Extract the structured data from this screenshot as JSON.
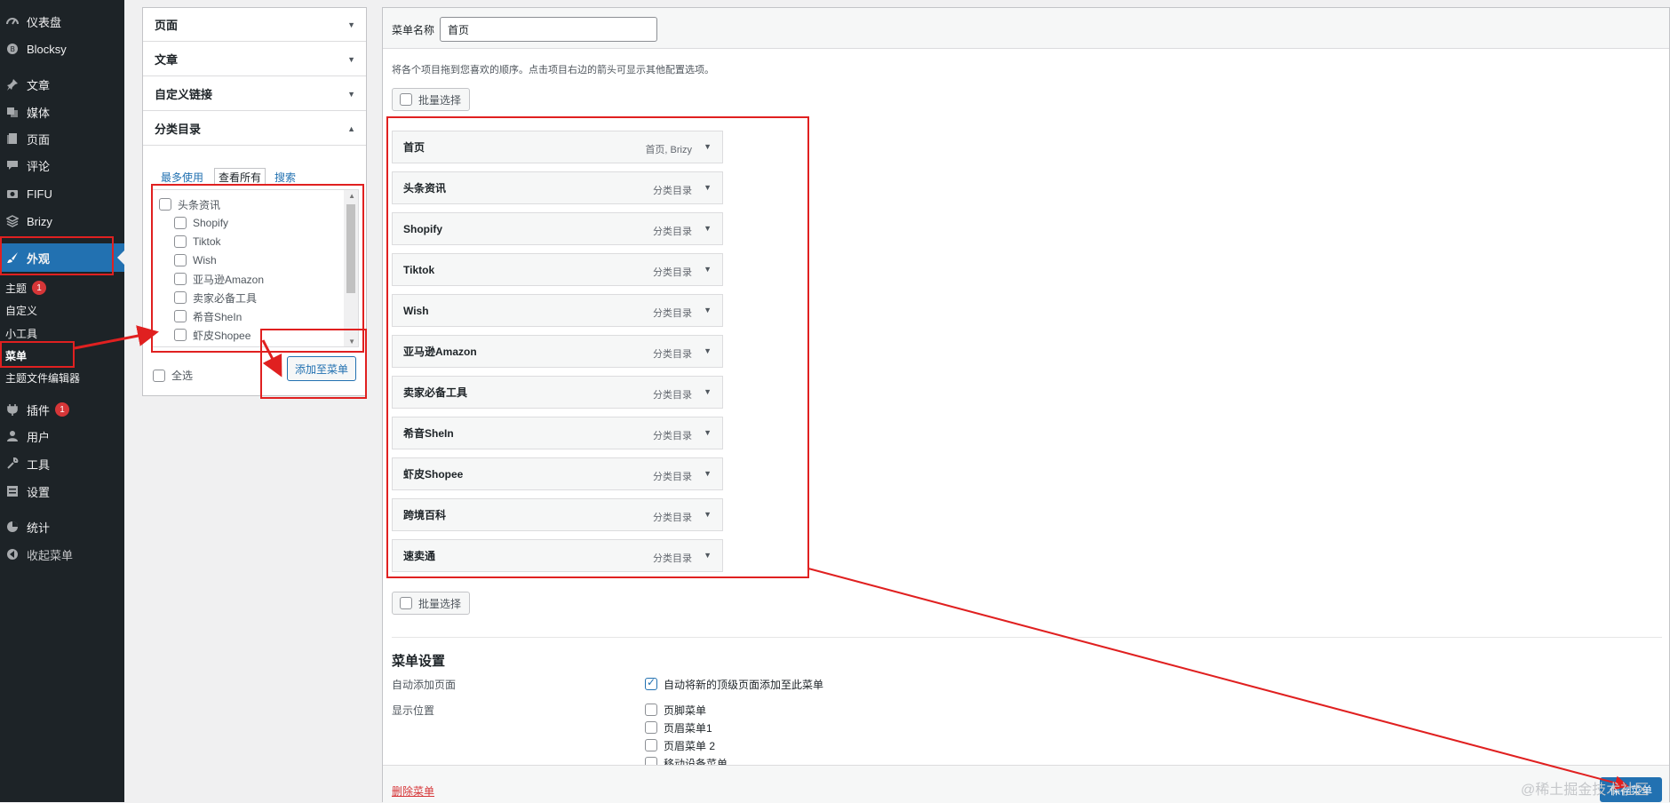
{
  "sidebar": {
    "items": [
      {
        "label": "仪表盘",
        "icon": "dashboard-icon"
      },
      {
        "label": "Blocksy",
        "icon": "blocksy-icon"
      },
      {
        "label": "文章",
        "icon": "pin-icon"
      },
      {
        "label": "媒体",
        "icon": "media-icon"
      },
      {
        "label": "页面",
        "icon": "page-icon"
      },
      {
        "label": "评论",
        "icon": "comment-icon"
      },
      {
        "label": "FIFU",
        "icon": "camera-icon"
      },
      {
        "label": "Brizy",
        "icon": "brizy-icon"
      },
      {
        "label": "外观",
        "icon": "brush-icon"
      },
      {
        "label": "插件",
        "icon": "plugin-icon",
        "badge": "1"
      },
      {
        "label": "用户",
        "icon": "user-icon"
      },
      {
        "label": "工具",
        "icon": "wrench-icon"
      },
      {
        "label": "设置",
        "icon": "settings-icon"
      },
      {
        "label": "统计",
        "icon": "pie-chart-icon"
      },
      {
        "label": "收起菜单",
        "icon": "collapse-icon"
      }
    ],
    "submenu": [
      {
        "label": "主题",
        "badge": "1"
      },
      {
        "label": "自定义"
      },
      {
        "label": "小工具"
      },
      {
        "label": "菜单"
      },
      {
        "label": "主题文件编辑器"
      }
    ]
  },
  "accordion": {
    "sections": [
      "页面",
      "文章",
      "自定义链接",
      "分类目录"
    ],
    "tabs": [
      "最多使用",
      "查看所有",
      "搜索"
    ],
    "categories": [
      "头条资讯",
      "Shopify",
      "Tiktok",
      "Wish",
      "亚马逊Amazon",
      "卖家必备工具",
      "希音SheIn",
      "虾皮Shopee"
    ],
    "select_all": "全选",
    "add_button": "添加至菜单"
  },
  "editor": {
    "menu_name_label": "菜单名称",
    "menu_name_value": "首页",
    "instructions": "将各个项目拖到您喜欢的顺序。点击项目右边的箭头可显示其他配置选项。",
    "bulk_select": "批量选择",
    "items": [
      {
        "title": "首页",
        "type": "首页, Brizy"
      },
      {
        "title": "头条资讯",
        "type": "分类目录"
      },
      {
        "title": "Shopify",
        "type": "分类目录"
      },
      {
        "title": "Tiktok",
        "type": "分类目录"
      },
      {
        "title": "Wish",
        "type": "分类目录"
      },
      {
        "title": "亚马逊Amazon",
        "type": "分类目录"
      },
      {
        "title": "卖家必备工具",
        "type": "分类目录"
      },
      {
        "title": "希音SheIn",
        "type": "分类目录"
      },
      {
        "title": "虾皮Shopee",
        "type": "分类目录"
      },
      {
        "title": "跨境百科",
        "type": "分类目录"
      },
      {
        "title": "速卖通",
        "type": "分类目录"
      }
    ],
    "settings": {
      "title": "菜单设置",
      "auto_add_label": "自动添加页面",
      "auto_add_option": "自动将新的顶级页面添加至此菜单",
      "auto_add_checked": true,
      "location_label": "显示位置",
      "locations": [
        "页脚菜单",
        "页眉菜单1",
        "页眉菜单 2",
        "移动设备菜单"
      ]
    },
    "delete_label": "删除菜单",
    "save_label": "保存菜单"
  },
  "watermark": "@稀土掘金技术社区",
  "colors": {
    "admin_bar": "#1d2327",
    "accent": "#2271b1",
    "annotation": "#e02020",
    "danger": "#d63638"
  }
}
